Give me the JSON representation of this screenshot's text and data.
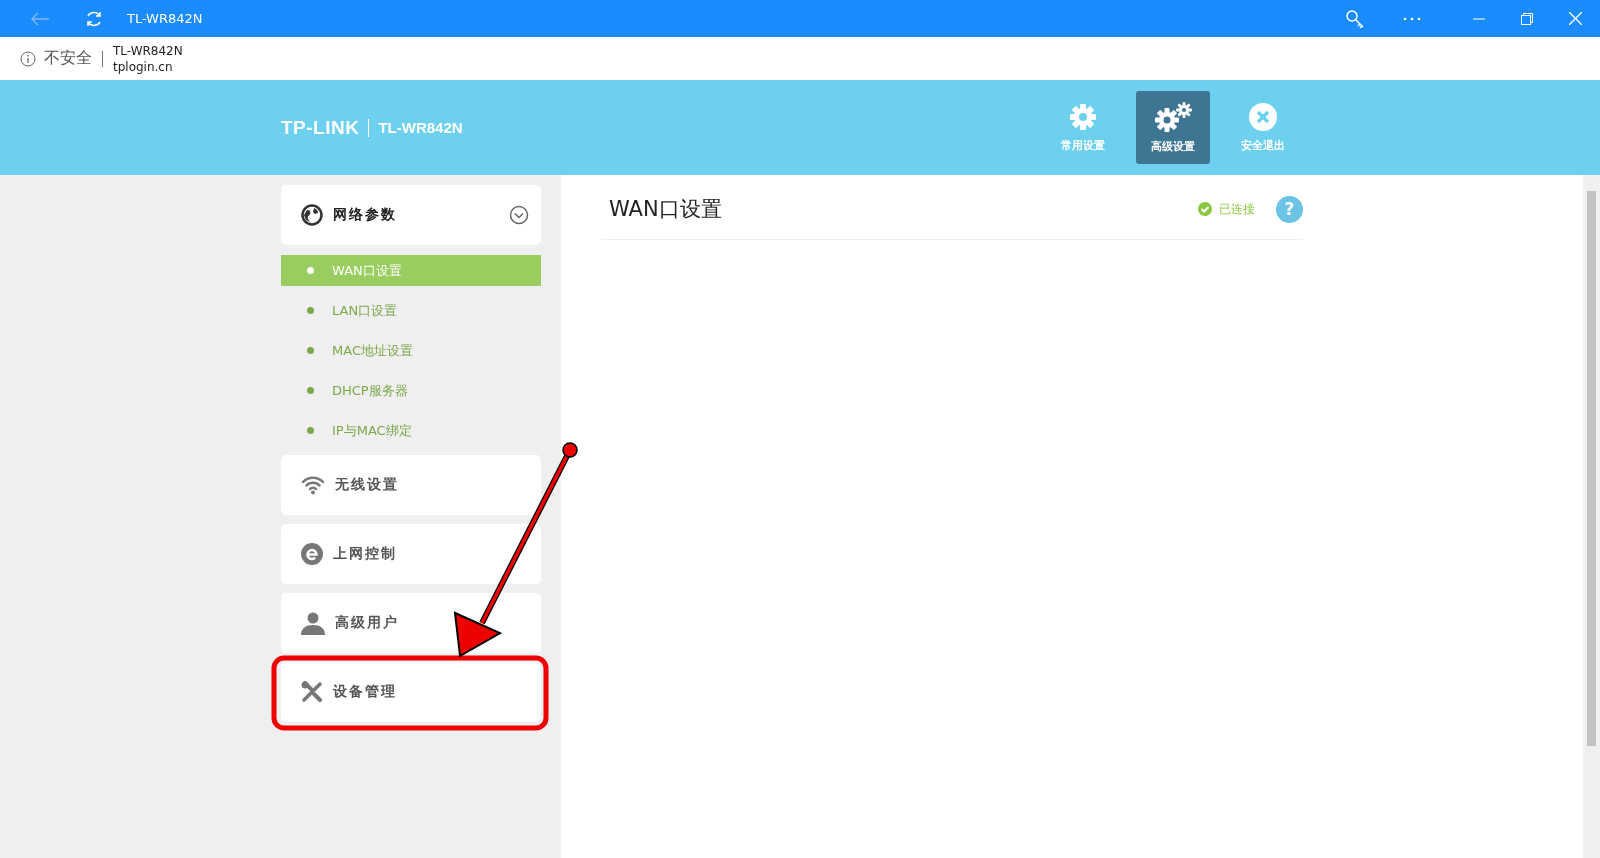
{
  "browser": {
    "tab_title": "TL-WR842N",
    "security": "不安全",
    "site_title": "TL-WR842N",
    "url": "tplogin.cn"
  },
  "header": {
    "brand": "TP-LINK",
    "model": "TL-WR842N",
    "nav": [
      {
        "label": "常用设置",
        "kind": "gear",
        "selected": false
      },
      {
        "label": "高级设置",
        "kind": "gears",
        "selected": true
      },
      {
        "label": "安全退出",
        "kind": "exit",
        "selected": false
      }
    ]
  },
  "sidebar": [
    {
      "label": "网络参数",
      "kind": "globe",
      "expanded": true,
      "children": [
        {
          "label": "WAN口设置",
          "selected": true
        },
        {
          "label": "LAN口设置",
          "selected": false
        },
        {
          "label": "MAC地址设置",
          "selected": false
        },
        {
          "label": "DHCP服务器",
          "selected": false
        },
        {
          "label": "IP与MAC绑定",
          "selected": false
        }
      ]
    },
    {
      "label": "无线设置",
      "kind": "wifi",
      "expanded": false
    },
    {
      "label": "上网控制",
      "kind": "browser",
      "expanded": false
    },
    {
      "label": "高级用户",
      "kind": "user",
      "expanded": false
    },
    {
      "label": "设备管理",
      "kind": "tools",
      "expanded": false
    }
  ],
  "content": {
    "title": "WAN口设置",
    "status": "已连接",
    "help": "?"
  }
}
